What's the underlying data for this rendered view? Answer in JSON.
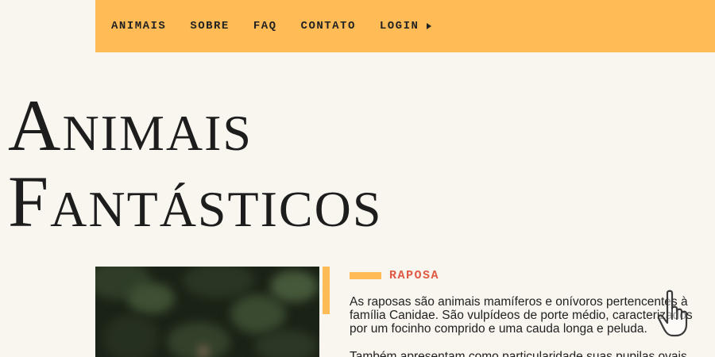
{
  "nav": {
    "items": [
      "ANIMAIS",
      "SOBRE",
      "FAQ",
      "CONTATO",
      "LOGIN"
    ]
  },
  "hero": {
    "line1": "Animais",
    "line2": "Fantásticos"
  },
  "article": {
    "heading": "RAPOSA",
    "paragraph1": "As raposas são animais mamíferos e onívoros pertencentes à família Canidae. São vulpídeos de porte médio, caracterizados por um focinho comprido e uma cauda longa e peluda.",
    "paragraph2": "Também apresentam como particularidade suas pupilas ovais"
  },
  "colors": {
    "background": "#f9f5ef",
    "nav_bg": "#ffbb55",
    "accent": "#ffbb55",
    "heading_red": "#e05a44",
    "text": "#222222"
  },
  "icons": {
    "login": "play-triangle-icon",
    "cursor": "hand-pointer-cursor-icon"
  }
}
